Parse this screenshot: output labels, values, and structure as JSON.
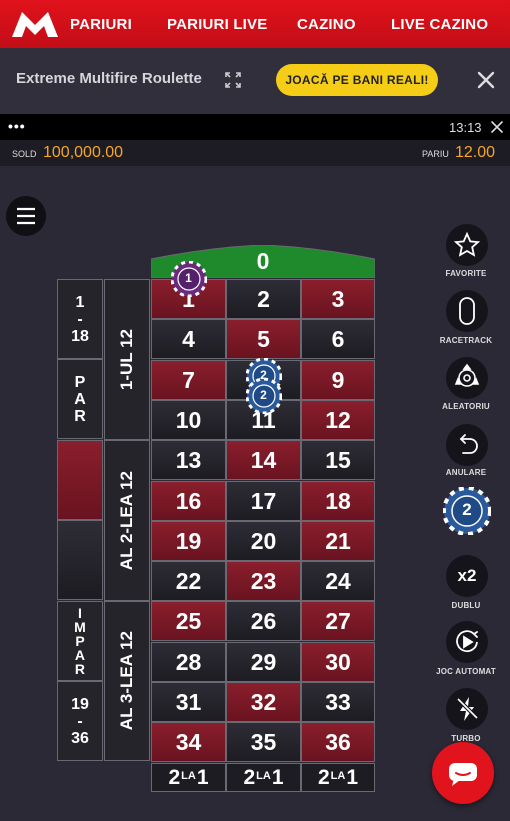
{
  "nav": {
    "items": [
      "PARIURI",
      "PARIURI LIVE",
      "CAZINO",
      "LIVE CAZINO"
    ]
  },
  "game": {
    "title": "Extreme Multifire Roulette",
    "play_real_label": "JOACĂ PE BANI REALI!"
  },
  "status": {
    "dots": "•••",
    "time": "13:13"
  },
  "balance": {
    "sold_label": "SOLD",
    "sold_value": "100,000.00",
    "bet_label": "PARIU",
    "bet_value": "12.00"
  },
  "table": {
    "zero": "0",
    "numbers": [
      [
        "1",
        "2",
        "3"
      ],
      [
        "4",
        "5",
        "6"
      ],
      [
        "7",
        "8",
        "9"
      ],
      [
        "10",
        "11",
        "12"
      ],
      [
        "13",
        "14",
        "15"
      ],
      [
        "16",
        "17",
        "18"
      ],
      [
        "19",
        "20",
        "21"
      ],
      [
        "22",
        "23",
        "24"
      ],
      [
        "25",
        "26",
        "27"
      ],
      [
        "28",
        "29",
        "30"
      ],
      [
        "31",
        "32",
        "33"
      ],
      [
        "34",
        "35",
        "36"
      ]
    ],
    "red_numbers": [
      "1",
      "3",
      "5",
      "7",
      "9",
      "12",
      "14",
      "16",
      "18",
      "19",
      "21",
      "23",
      "25",
      "27",
      "30",
      "32",
      "34",
      "36"
    ],
    "outside": {
      "low": [
        "1",
        "-",
        "18"
      ],
      "even": [
        "P",
        "A",
        "R"
      ],
      "odd": [
        "I",
        "M",
        "P",
        "A",
        "R"
      ],
      "high": [
        "19",
        "-",
        "36"
      ],
      "dozen1": "1-UL 12",
      "dozen2": "AL 2-LEA 12",
      "dozen3": "AL 3-LEA 12"
    },
    "column_bet": {
      "left": "2",
      "mid": "LA",
      "right": "1"
    },
    "chips": [
      {
        "on": "1",
        "value": "1"
      },
      {
        "on": "8",
        "value": "2"
      },
      {
        "on": "11",
        "value": "2"
      }
    ]
  },
  "controls": {
    "favorite": "FAVORITE",
    "racetrack": "RACETRACK",
    "random": "ALEATORIU",
    "undo": "ANULARE",
    "selected_chip": "2",
    "double_icon": "x2",
    "double": "DUBLU",
    "autoplay": "JOC AUTOMAT",
    "turbo": "TURBO"
  },
  "colors": {
    "brand_red": "#d9101a",
    "accent_yellow": "#f5cd16",
    "balance_orange": "#f5a623",
    "zero_green": "#1e8a2c",
    "chip_purple": "#6b2a7d",
    "chip_blue": "#2a5a9c"
  }
}
